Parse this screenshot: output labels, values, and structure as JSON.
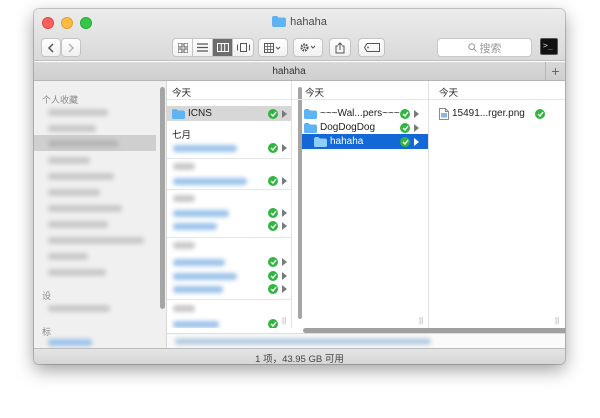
{
  "window": {
    "title": "hahaha"
  },
  "toolbar": {
    "search_placeholder": "搜索",
    "action_icon": "gear-icon",
    "share_icon": "share-icon",
    "tags_icon": "tag-icon"
  },
  "tab": {
    "label": "hahaha",
    "add_label": "+"
  },
  "sidebar": {
    "sections": [
      {
        "label": "个人收藏"
      },
      {
        "label": "设"
      },
      {
        "label": "标"
      }
    ]
  },
  "columns": [
    {
      "header": "今天",
      "rows": [
        {
          "label": "ICNS",
          "type": "folder",
          "selected": "grey",
          "synced": true,
          "has_children": true
        },
        {
          "label": "七月",
          "type": "group-header"
        }
      ]
    },
    {
      "header": "今天",
      "rows": [
        {
          "label": "~~~Wal...pers~~~",
          "type": "folder",
          "synced": true,
          "has_children": true
        },
        {
          "label": "DogDogDog",
          "type": "folder",
          "synced": true,
          "has_children": true
        },
        {
          "label": "hahaha",
          "type": "folder",
          "selected": "blue",
          "synced": true,
          "has_children": true
        }
      ]
    },
    {
      "header": "今天",
      "rows": [
        {
          "label": "15491...rger.png",
          "type": "file",
          "synced": true
        }
      ]
    }
  ],
  "status": {
    "text": "1 项，43.95 GB 可用"
  },
  "colors": {
    "selection_blue": "#1367d6",
    "sync_green": "#31b541",
    "folder_blue": "#5eb4f2"
  }
}
